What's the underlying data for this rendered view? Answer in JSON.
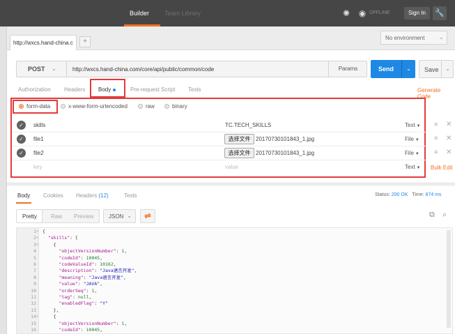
{
  "topbar": {
    "builder_label": "Builder",
    "team_library_label": "Team Library",
    "offline_label": "OFFLINE",
    "sign_in_label": "Sign In"
  },
  "tabs": {
    "request_tab_label": "http://wxcs.hand-china.c",
    "add_tab_label": "+",
    "environment_label": "No environment"
  },
  "request": {
    "method": "POST",
    "url": "http://wxcs.hand-china.com/core/api/public/common/code",
    "params_label": "Params",
    "send_label": "Send",
    "save_label": "Save"
  },
  "subtabs": [
    "Authorization",
    "Headers",
    "Body",
    "Pre-request Script",
    "Tests"
  ],
  "generate_code_label": "Generate Code",
  "body_modes": [
    "form-data",
    "x-www-form-urlencoded",
    "raw",
    "binary"
  ],
  "form_rows": [
    {
      "key": "skills",
      "value": "TC.TECH_SKILLS",
      "type": "Text"
    },
    {
      "key": "file1",
      "file_button": "选择文件",
      "filename": "20170730101843_1.jpg",
      "type": "File"
    },
    {
      "key": "file2",
      "file_button": "选择文件",
      "filename": "20170730101843_1.jpg",
      "type": "File"
    },
    {
      "key": "key",
      "value": "value",
      "type": "Text"
    }
  ],
  "bulk_edit_label": "Bulk Edit",
  "response": {
    "tabs": [
      "Body",
      "Cookies",
      "Headers",
      "Tests"
    ],
    "headers_count": "(12)",
    "status_label": "Status:",
    "status_value": "200 OK",
    "time_label": "Time:",
    "time_value": "874 ms",
    "views": [
      "Pretty",
      "Raw",
      "Preview"
    ],
    "format": "JSON"
  },
  "code_lines": [
    {
      "n": "1",
      "fold": true,
      "t": "{"
    },
    {
      "n": "2",
      "fold": true,
      "t": "  \"skills\": ["
    },
    {
      "n": "3",
      "fold": true,
      "t": "    {"
    },
    {
      "n": "4",
      "fold": false,
      "t": "      \"objectVersionNumber\": 1,"
    },
    {
      "n": "5",
      "fold": false,
      "t": "      \"codeId\": 10045,"
    },
    {
      "n": "6",
      "fold": false,
      "t": "      \"codeValueId\": 10162,"
    },
    {
      "n": "7",
      "fold": false,
      "t": "      \"description\": \"Java语言开发\","
    },
    {
      "n": "8",
      "fold": false,
      "t": "      \"meaning\": \"Java语言开发\","
    },
    {
      "n": "9",
      "fold": false,
      "t": "      \"value\": \"JAVA\","
    },
    {
      "n": "10",
      "fold": false,
      "t": "      \"orderSeq\": 1,"
    },
    {
      "n": "11",
      "fold": false,
      "t": "      \"tag\": null,"
    },
    {
      "n": "12",
      "fold": false,
      "t": "      \"enabledFlag\": \"Y\""
    },
    {
      "n": "13",
      "fold": false,
      "t": "    },"
    },
    {
      "n": "14",
      "fold": true,
      "t": "    {"
    },
    {
      "n": "15",
      "fold": false,
      "t": "      \"objectVersionNumber\": 1,"
    },
    {
      "n": "16",
      "fold": false,
      "t": "      \"codeId\": 10045,"
    }
  ],
  "colors": {
    "accent": "#f47023",
    "send": "#1e88e5",
    "highlight_box": "#e4393c"
  }
}
